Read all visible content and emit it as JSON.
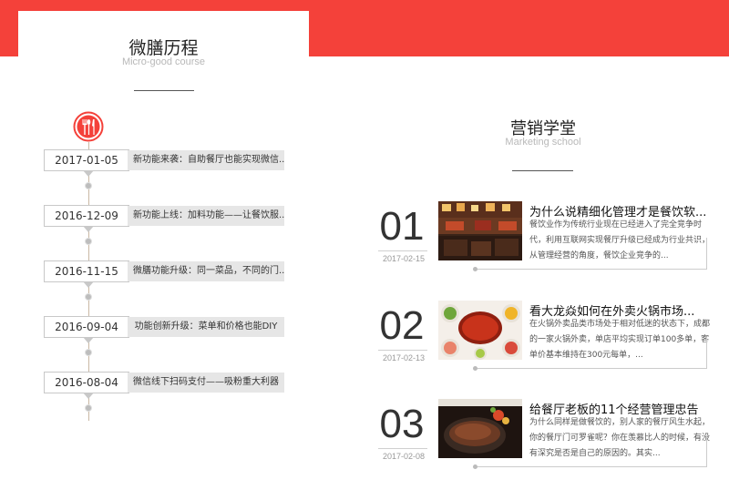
{
  "left_panel": {
    "title": "微膳历程",
    "subtitle": "Micro-good course",
    "icon": "fork-spoon-knife-icon",
    "timeline": [
      {
        "date": "2017-01-05",
        "text": "新功能来袭：自助餐厅也能实现微信..."
      },
      {
        "date": "2016-12-09",
        "text": "新功能上线：加料功能——让餐饮服..."
      },
      {
        "date": "2016-11-15",
        "text": "微膳功能升级：同一菜品，不同的门..."
      },
      {
        "date": "2016-09-04",
        "text": "功能创新升级：菜单和价格也能DIY"
      },
      {
        "date": "2016-08-04",
        "text": "微信线下扫码支付——吸粉重大利器"
      }
    ]
  },
  "right_panel": {
    "title": "营销学堂",
    "subtitle": "Marketing school",
    "articles": [
      {
        "num": "01",
        "date": "2017-02-15",
        "title": "为什么说精细化管理才是餐饮软...",
        "excerpt": "餐饮业作为传统行业现在已经进入了完全竞争时代，利用互联网实现餐厅升级已经成为行业共识，从管理经营的角度，餐饮企业竞争的..."
      },
      {
        "num": "02",
        "date": "2017-02-13",
        "title": "看大龙焱如何在外卖火锅市场...",
        "excerpt": "在火锅外卖品类市场处于相对低迷的状态下，成都的一家火锅外卖，单店平均实现订单100多单，客单价基本维持在300元每单，..."
      },
      {
        "num": "03",
        "date": "2017-02-08",
        "title": "给餐厅老板的11个经营管理忠告",
        "excerpt": "为什么同样是做餐饮的，别人家的餐厅风生水起，你的餐厅门可罗雀呢？你在羡慕比人的时候，有没有深究是否是自己的原因的。其实..."
      }
    ]
  },
  "colors": {
    "brand": "#f4413a",
    "tag_bg": "#e6e6e6",
    "timeline_axis": "#c9b8a4"
  }
}
